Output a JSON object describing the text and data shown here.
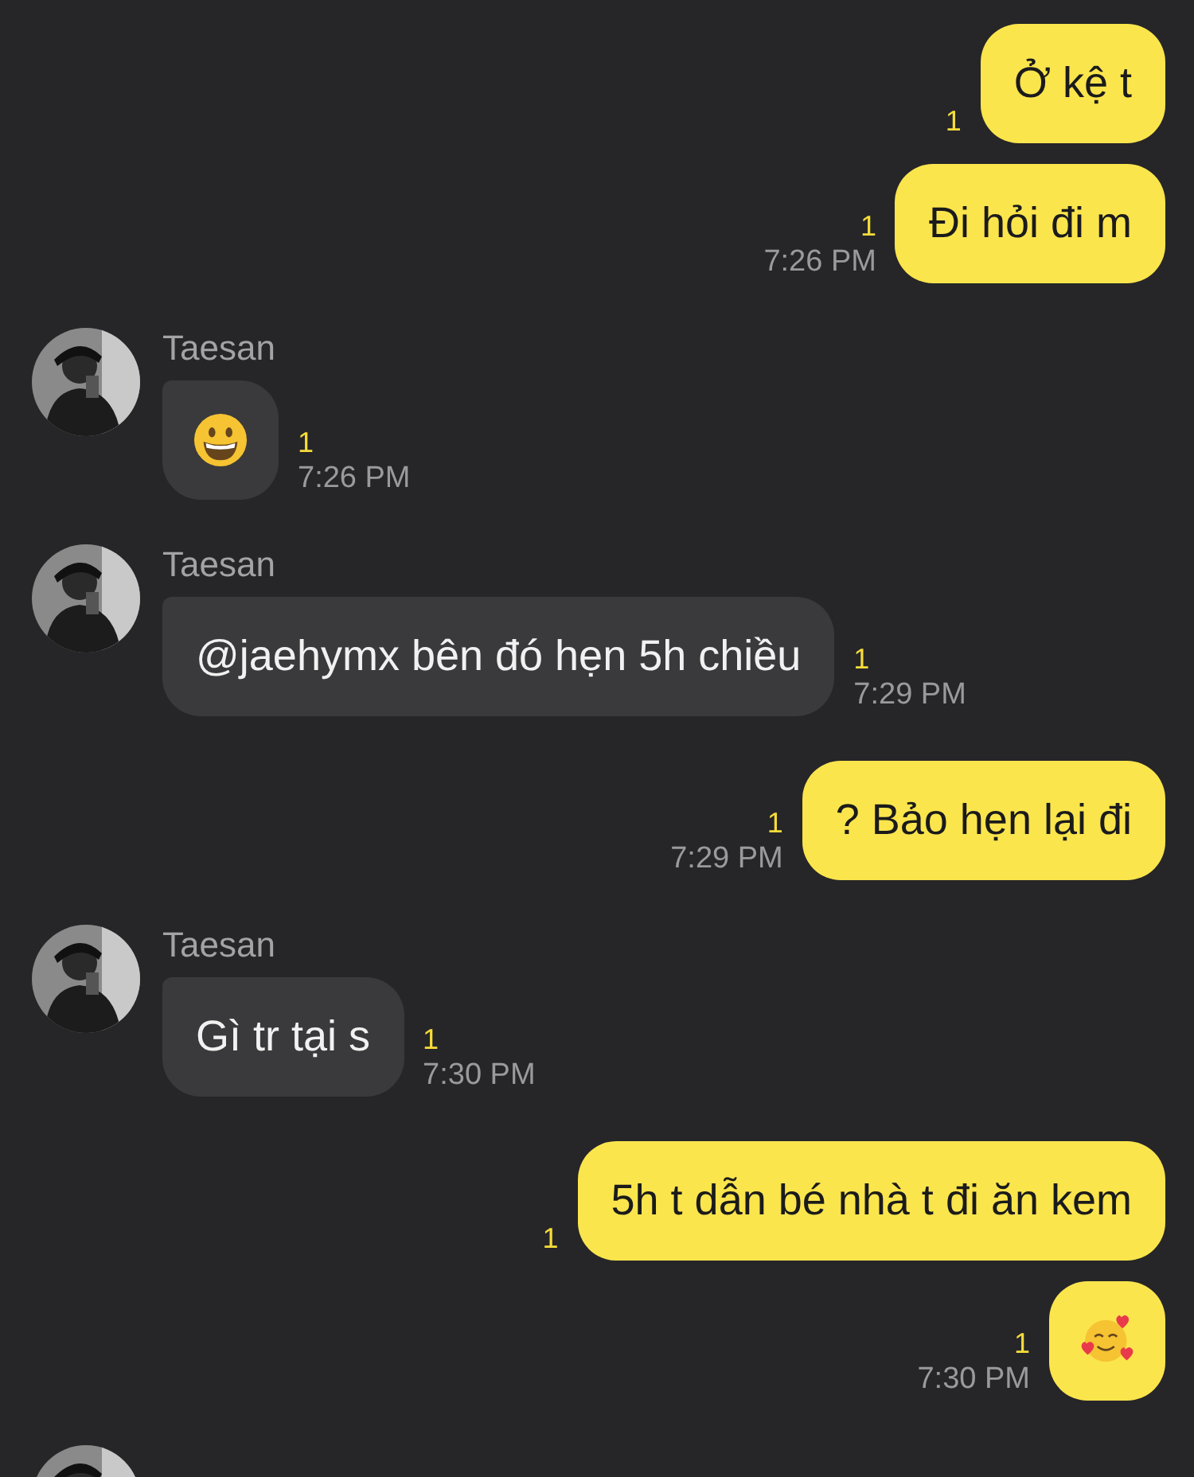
{
  "groups": [
    {
      "kind": "sent",
      "messages": [
        {
          "kind": "text",
          "text": "Ở kệ t",
          "unread": "1"
        },
        {
          "kind": "text",
          "text": "Đi hỏi đi m",
          "unread": "1",
          "time": "7:26 PM"
        }
      ]
    },
    {
      "kind": "received",
      "sender": "Taesan",
      "messages": [
        {
          "kind": "grin-emoji",
          "unread": "1",
          "time": "7:26 PM"
        }
      ]
    },
    {
      "kind": "received",
      "sender": "Taesan",
      "messages": [
        {
          "kind": "text",
          "text": "@jaehymx bên đó hẹn 5h chiều",
          "unread": "1",
          "time": "7:29 PM"
        }
      ]
    },
    {
      "kind": "sent",
      "messages": [
        {
          "kind": "text",
          "text": "? Bảo hẹn lại đi",
          "unread": "1",
          "time": "7:29 PM"
        }
      ]
    },
    {
      "kind": "received",
      "sender": "Taesan",
      "messages": [
        {
          "kind": "text",
          "text": "Gì tr tại s",
          "unread": "1",
          "time": "7:30 PM"
        }
      ]
    },
    {
      "kind": "sent",
      "messages": [
        {
          "kind": "text",
          "text": "5h t dẫn bé nhà t đi ăn kem",
          "unread": "1"
        },
        {
          "kind": "hearts-emoji",
          "unread": "1",
          "time": "7:30 PM"
        }
      ]
    },
    {
      "kind": "avatar-only"
    }
  ]
}
